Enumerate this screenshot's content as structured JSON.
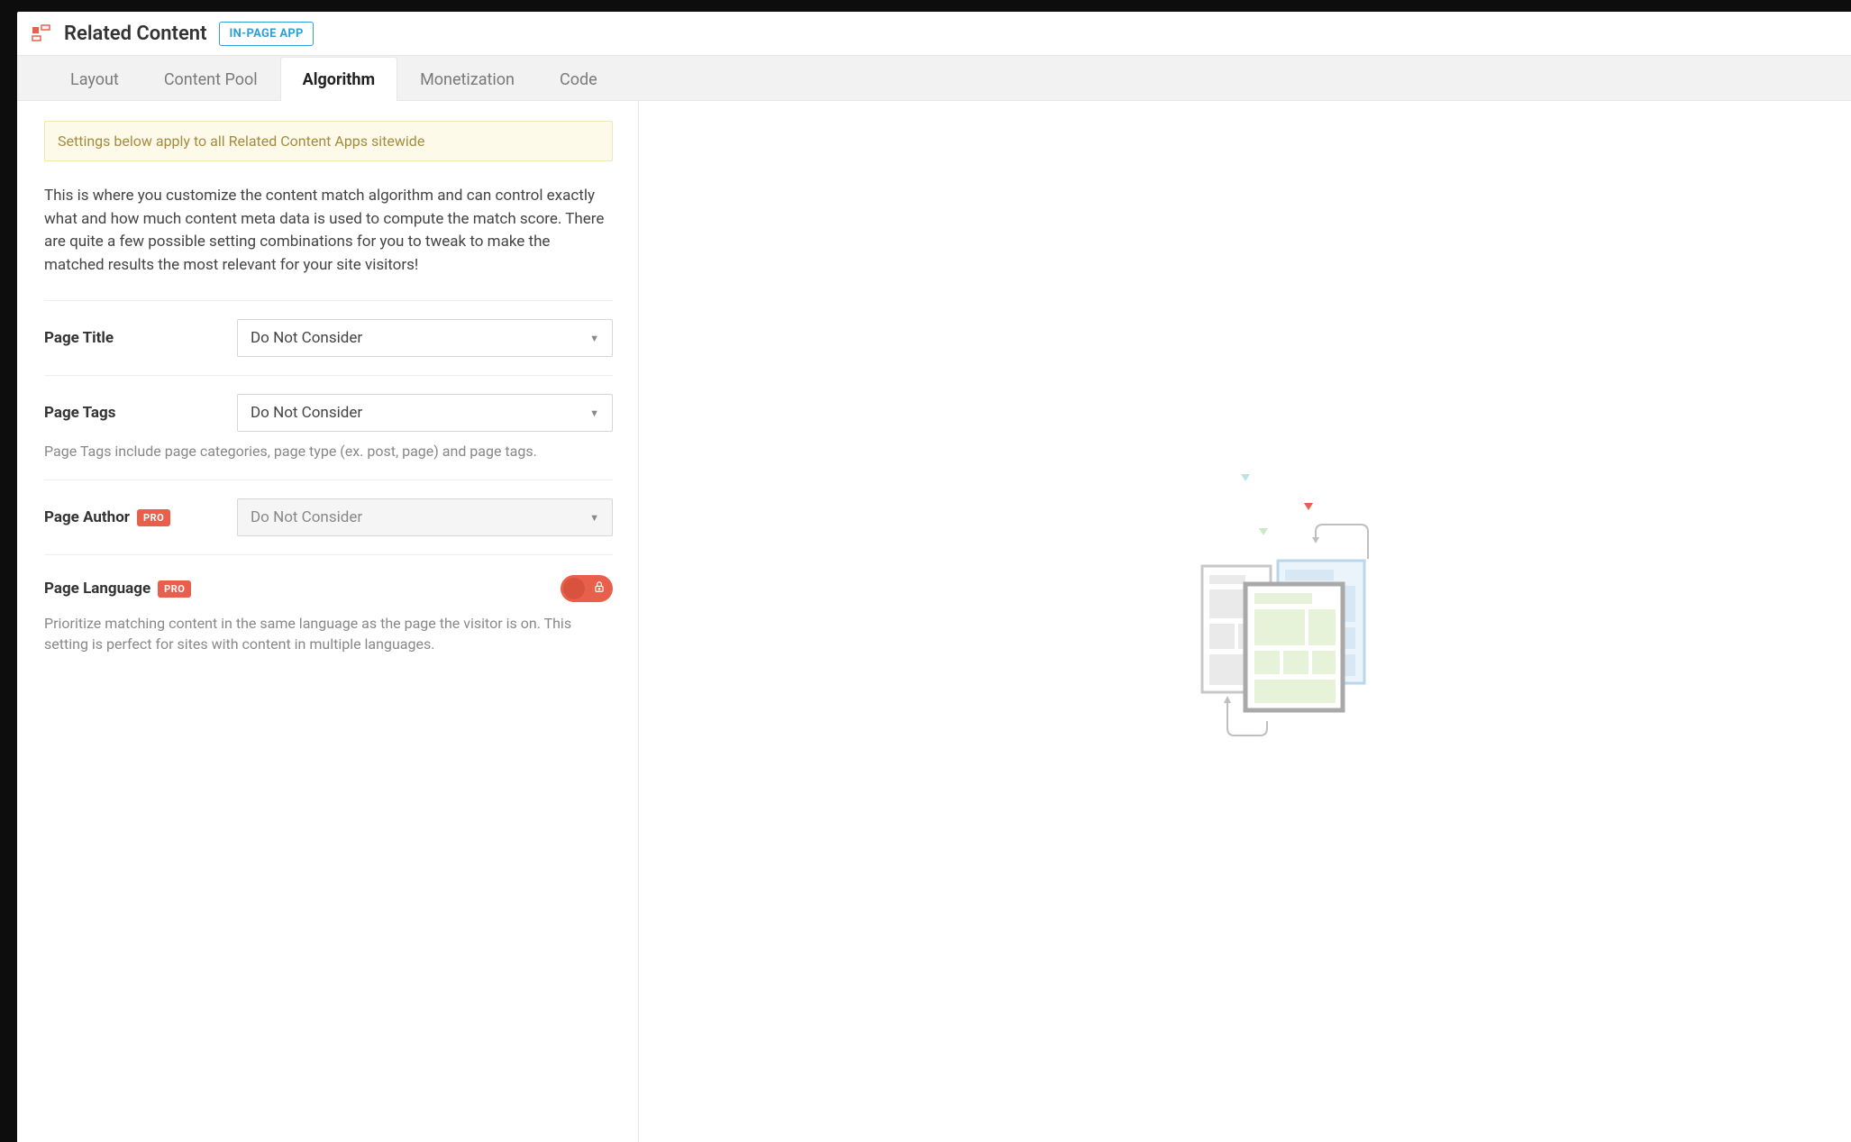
{
  "header": {
    "title": "Related Content",
    "badge": "IN-PAGE APP",
    "icon_name": "related-content-icon"
  },
  "tabs": [
    {
      "id": "layout",
      "label": "Layout",
      "active": false
    },
    {
      "id": "content-pool",
      "label": "Content Pool",
      "active": false
    },
    {
      "id": "algorithm",
      "label": "Algorithm",
      "active": true
    },
    {
      "id": "monetization",
      "label": "Monetization",
      "active": false
    },
    {
      "id": "code",
      "label": "Code",
      "active": false
    }
  ],
  "notice": "Settings below apply to all Related Content Apps sitewide",
  "intro": "This is where you customize the content match algorithm and can control exactly what and how much content meta data is used to compute the match score. There are quite a few possible setting combinations for you to tweak to make the matched results the most relevant for your site visitors!",
  "fields": {
    "page_title": {
      "label": "Page Title",
      "selected": "Do Not Consider"
    },
    "page_tags": {
      "label": "Page Tags",
      "selected": "Do Not Consider",
      "help": "Page Tags include page categories, page type (ex. post, page) and page tags."
    },
    "page_author": {
      "label": "Page Author",
      "pro": "PRO",
      "selected": "Do Not Consider",
      "disabled": true
    },
    "page_language": {
      "label": "Page Language",
      "pro": "PRO",
      "toggle": false,
      "help": "Prioritize matching content in the same language as the page the visitor is on. This setting is perfect for sites with content in multiple languages."
    }
  },
  "colors": {
    "accent_red": "#e8604c",
    "accent_blue": "#2f9fd8",
    "notice_bg": "#fdfae9",
    "notice_text": "#a48b3f"
  }
}
